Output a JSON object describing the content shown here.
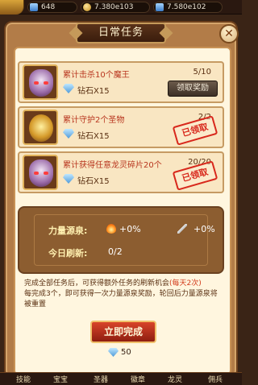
{
  "topbar": {
    "r1": {
      "value": "648",
      "icon": "gem-icon"
    },
    "r2": {
      "value": "7.380e103",
      "icon": "gold-coin-icon"
    },
    "r3": {
      "value": "7.580e102",
      "icon": "gem-icon"
    }
  },
  "dialog": {
    "title": "日常任务",
    "close_icon": "close-icon",
    "quests": [
      {
        "name": "累计击杀10个魔王",
        "progress": "5/10",
        "reward": "钻石X15",
        "action": "领取奖励",
        "status": ""
      },
      {
        "name": "累计守护2个圣物",
        "progress": "2/2",
        "reward": "钻石X15",
        "action": "",
        "status": "已领取"
      },
      {
        "name": "累计获得任意龙灵碎片20个",
        "progress": "20/20",
        "reward": "钻石X15",
        "action": "",
        "status": "已领取"
      }
    ],
    "power": {
      "label": "力量源泉:",
      "v1": "+0%",
      "v2": "+0%",
      "refresh_label": "今日刷新:",
      "refresh_value": "0/2"
    },
    "desc": {
      "p1": "完成全部任务后，可获得额外任务的刷新机会",
      "hl": "(每天2次)",
      "p2": "每完成3个，即可获得一次力量源泉奖励，轮回后力量源泉将被重置"
    },
    "complete_label": "立即完成",
    "cost": "50"
  },
  "bottomnav": [
    "技能",
    "宝宝",
    "圣器",
    "徽章",
    "龙灵",
    "佣兵"
  ],
  "colors": {
    "accent_red": "#b8351e",
    "stamp_red": "#d8281c",
    "panel_brown": "#8c5d30"
  }
}
